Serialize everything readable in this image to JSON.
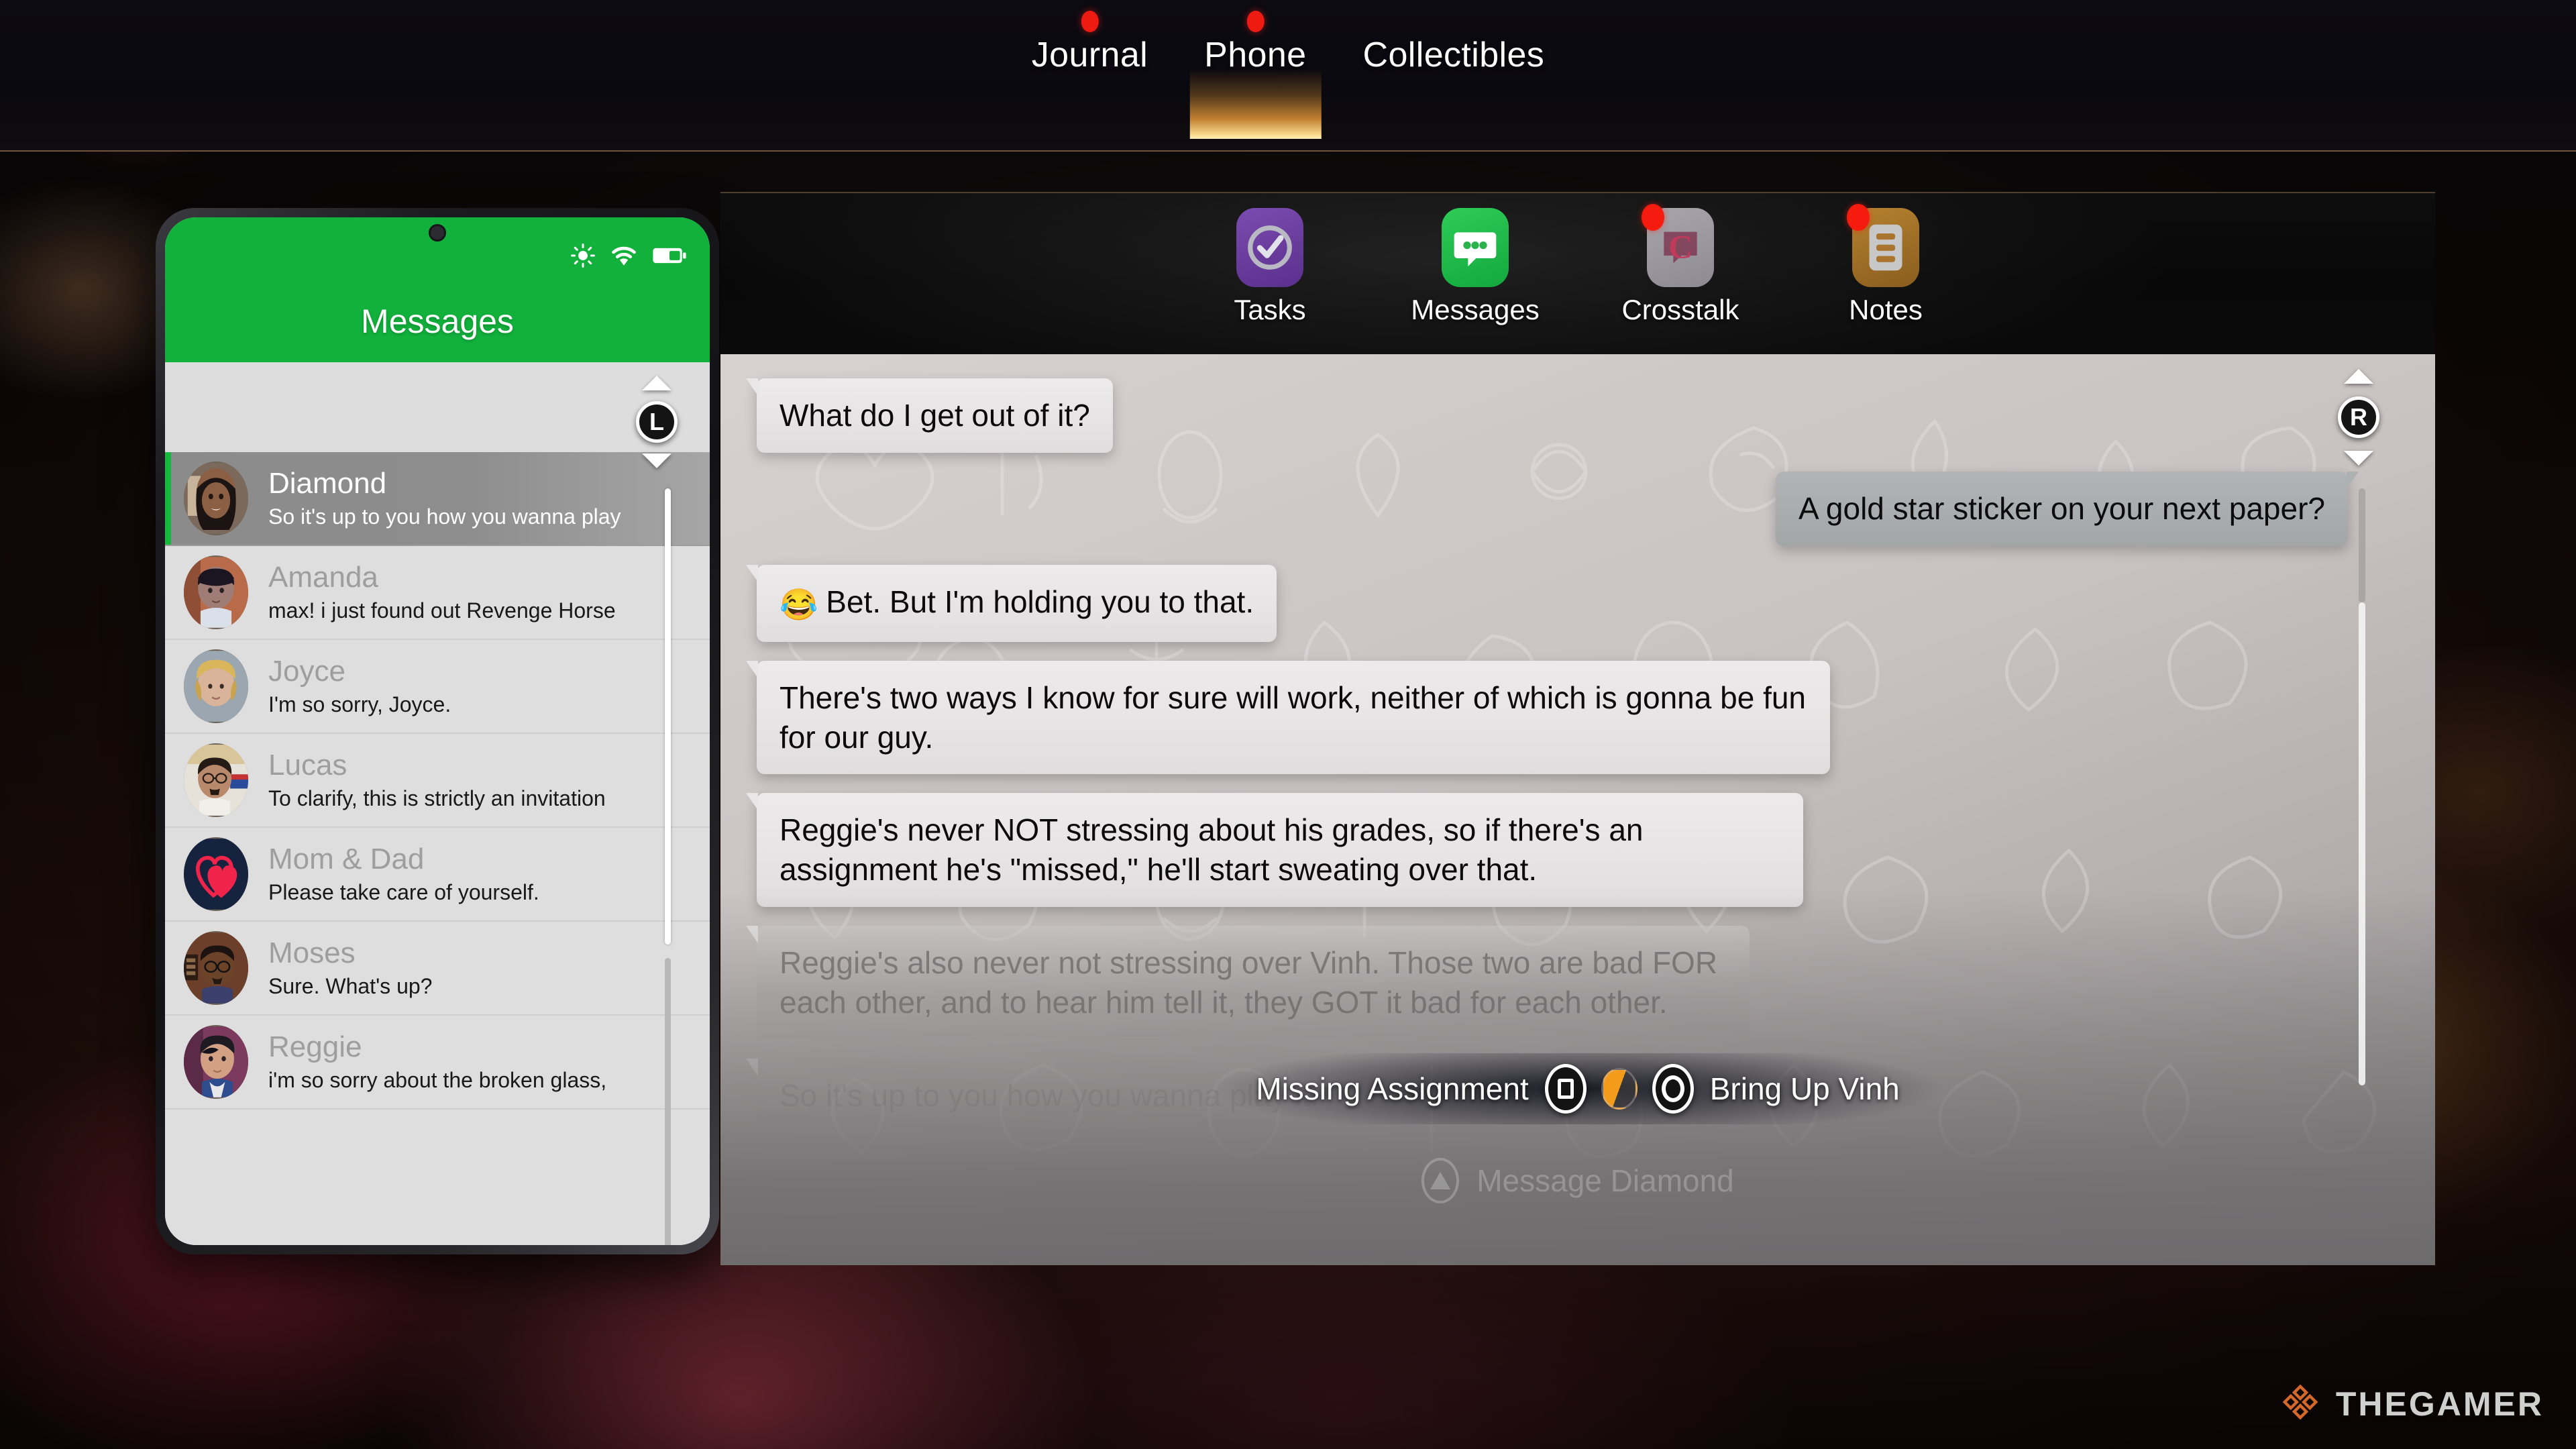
{
  "top_nav": {
    "tabs": [
      {
        "label": "Journal",
        "has_notification": true,
        "active": false
      },
      {
        "label": "Phone",
        "has_notification": true,
        "active": true
      },
      {
        "label": "Collectibles",
        "has_notification": false,
        "active": false
      }
    ]
  },
  "phone": {
    "title": "Messages",
    "status_icons": [
      "brightness-icon",
      "wifi-icon",
      "battery-icon"
    ],
    "bumper_hint": "L",
    "header_color": "#12b13c",
    "contacts": [
      {
        "name": "Diamond",
        "preview": "So it's up to you how you wanna play",
        "selected": true,
        "avatar": "diamond-avatar"
      },
      {
        "name": "Amanda",
        "preview": "max! i just found out Revenge Horse",
        "selected": false,
        "avatar": "amanda-avatar"
      },
      {
        "name": "Joyce",
        "preview": "I'm so sorry, Joyce.",
        "selected": false,
        "avatar": "joyce-avatar"
      },
      {
        "name": "Lucas",
        "preview": "To clarify, this is strictly an invitation",
        "selected": false,
        "avatar": "lucas-avatar"
      },
      {
        "name": "Mom & Dad",
        "preview": "Please take care of yourself.",
        "selected": false,
        "avatar": "hearts-avatar"
      },
      {
        "name": "Moses",
        "preview": "Sure. What's up?",
        "selected": false,
        "avatar": "moses-avatar"
      },
      {
        "name": "Reggie",
        "preview": "i'm so sorry about the broken glass,",
        "selected": false,
        "avatar": "reggie-avatar"
      }
    ]
  },
  "app_bar": {
    "apps": [
      {
        "label": "Tasks",
        "icon": "tasks-app-icon",
        "color": "#6b3fa0",
        "badge": false
      },
      {
        "label": "Messages",
        "icon": "messages-app-icon",
        "color": "#1db954",
        "badge": false
      },
      {
        "label": "Crosstalk",
        "icon": "crosstalk-app-icon",
        "color": "#9a9a9a",
        "badge": true
      },
      {
        "label": "Notes",
        "icon": "notes-app-icon",
        "color": "#a8742e",
        "badge": true
      }
    ]
  },
  "chat": {
    "bumper_hint": "R",
    "messages": [
      {
        "side": "in",
        "text": "What do I get out of it?",
        "emoji": "",
        "opacity": "full"
      },
      {
        "side": "out",
        "text": "A gold star sticker on your next paper?",
        "emoji": "",
        "opacity": "full"
      },
      {
        "side": "in",
        "text": "Bet. But I'm holding you to that.",
        "emoji": "😂",
        "opacity": "full"
      },
      {
        "side": "in",
        "text": "There's two ways I know for sure will work, neither of which is gonna be fun for our guy.",
        "emoji": "",
        "opacity": "full"
      },
      {
        "side": "in",
        "text": "Reggie's never NOT stressing about his grades, so if there's an assignment he's \"missed,\" he'll start sweating over that.",
        "emoji": "",
        "opacity": "full"
      },
      {
        "side": "in",
        "text": "Reggie's also never not stressing over Vinh. Those two are bad FOR each other, and to hear him tell it, they GOT it bad for each other.",
        "emoji": "",
        "opacity": "faded"
      },
      {
        "side": "in",
        "text": "So it's up to you how you wanna play it.",
        "emoji": "",
        "opacity": "faded2"
      }
    ]
  },
  "prompts": {
    "left_choice": "Missing Assignment",
    "left_button": "square-button-icon",
    "right_choice": "Bring Up Vinh",
    "right_button": "circle-button-icon",
    "timer": "choice-timer-icon",
    "message_action": "Message Diamond",
    "message_button": "triangle-button-icon"
  },
  "watermark": {
    "text": "THEGAMER",
    "logo": "thegamer-logo-icon",
    "accent": "#d4682a"
  }
}
